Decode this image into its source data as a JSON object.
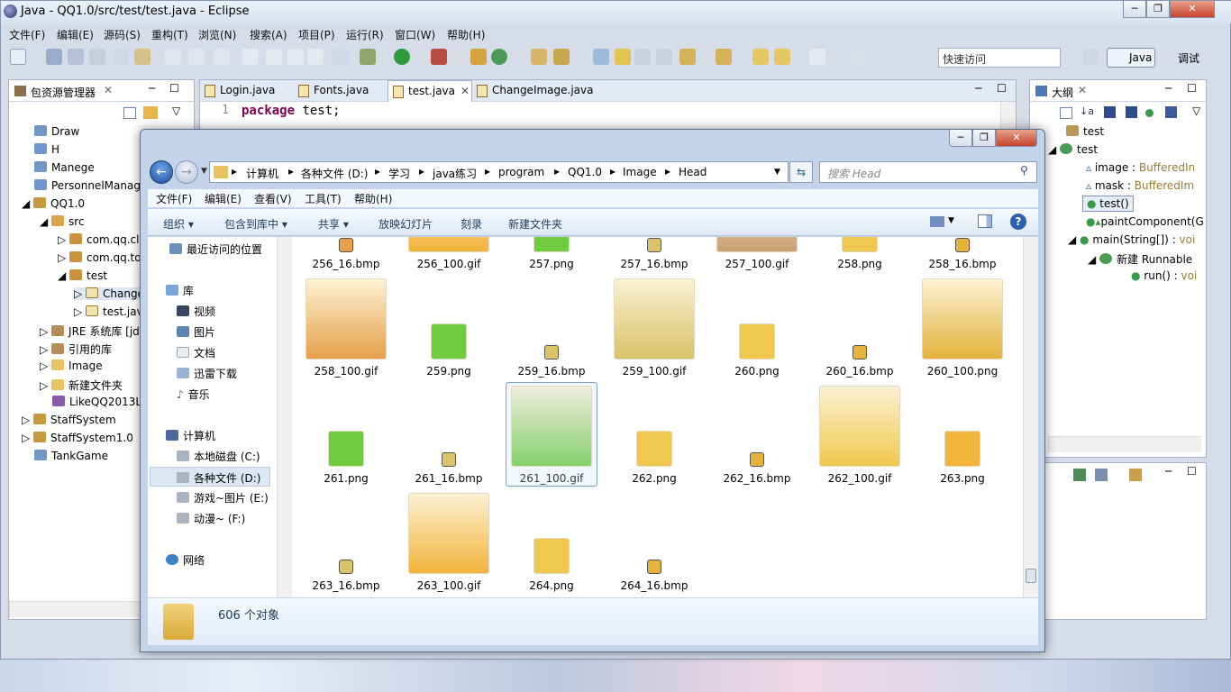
{
  "eclipse": {
    "title": "Java - QQ1.0/src/test/test.java - Eclipse",
    "menu": [
      "文件(F)",
      "编辑(E)",
      "源码(S)",
      "重构(T)",
      "浏览(N)",
      "搜索(A)",
      "项目(P)",
      "运行(R)",
      "窗口(W)",
      "帮助(H)"
    ],
    "quick_access": "快速访问",
    "perspectives": {
      "java": "Java",
      "debug": "调试"
    },
    "package_explorer": {
      "title": "包资源管理器",
      "items": [
        "Draw",
        "H",
        "Manege",
        "PersonnelManag",
        "QQ1.0",
        "src",
        "com.qq.cli",
        "com.qq.to",
        "test",
        "Change",
        "test.jav",
        "JRE 系统库 [jd",
        "引用的库",
        "Image",
        "新建文件夹",
        "LikeQQ2013L",
        "StaffSystem",
        "StaffSystem1.0",
        "TankGame"
      ]
    },
    "editor": {
      "tabs": [
        "Login.java",
        "Fonts.java",
        "test.java",
        "ChangeImage.java"
      ],
      "line_no": "1",
      "code_keyword": "package",
      "code_rest": " test;"
    },
    "outline": {
      "title": "大纲",
      "items": [
        "test",
        "test",
        "image",
        "BufferedIn",
        "mask",
        "BufferedIm",
        "test()",
        "paintComponent(G",
        "main(String[])",
        "voi",
        "新建 Runnable",
        "run()",
        "voi"
      ]
    }
  },
  "explorer": {
    "breadcrumb": [
      "计算机",
      "各种文件 (D:)",
      "学习",
      "java练习",
      "program",
      "QQ1.0",
      "Image",
      "Head"
    ],
    "search_placeholder": "搜索 Head",
    "menu": [
      "文件(F)",
      "编辑(E)",
      "查看(V)",
      "工具(T)",
      "帮助(H)"
    ],
    "commands": [
      "组织",
      "包含到库中",
      "共享",
      "放映幻灯片",
      "刻录",
      "新建文件夹"
    ],
    "nav": [
      "最近访问的位置",
      "库",
      "视频",
      "图片",
      "文档",
      "迅雷下载",
      "音乐",
      "计算机",
      "本地磁盘 (C:)",
      "各种文件 (D:)",
      "游戏~图片 (E:)",
      "动漫~ (F:)",
      "网络"
    ],
    "files_row0": [
      "256_16.bmp",
      "256_100.gif",
      "257.png",
      "257_16.bmp",
      "257_100.gif",
      "258.png",
      "258_16.bmp"
    ],
    "files_row1": [
      "258_100.gif",
      "259.png",
      "259_16.bmp",
      "259_100.gif",
      "260.png",
      "260_16.bmp",
      "260_100.png"
    ],
    "files_row2": [
      "261.png",
      "261_16.bmp",
      "261_100.gif",
      "262.png",
      "262_16.bmp",
      "262_100.gif",
      "263.png"
    ],
    "files_row3": [
      "263_16.bmp",
      "263_100.gif",
      "264.png",
      "264_16.bmp"
    ],
    "status": "606 个对象"
  }
}
